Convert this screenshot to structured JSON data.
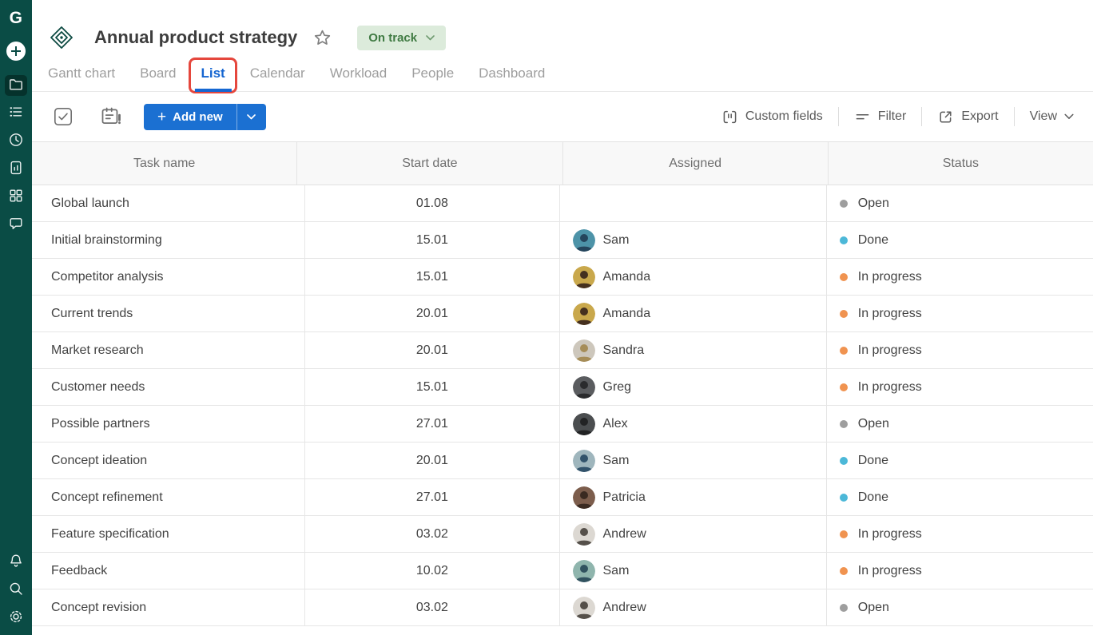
{
  "app": {
    "logo_letter": "G"
  },
  "sidebar": {
    "items": [
      {
        "name": "projects",
        "icon": "folder-icon",
        "active": true
      },
      {
        "name": "task-list",
        "icon": "list-icon",
        "active": false
      },
      {
        "name": "history",
        "icon": "clock-icon",
        "active": false
      },
      {
        "name": "reports",
        "icon": "report-icon",
        "active": false
      },
      {
        "name": "portfolio",
        "icon": "grid-icon",
        "active": false
      },
      {
        "name": "comments",
        "icon": "chat-icon",
        "active": false
      }
    ],
    "bottom_items": [
      {
        "name": "notifications",
        "icon": "bell-icon"
      },
      {
        "name": "search",
        "icon": "search-icon"
      },
      {
        "name": "settings",
        "icon": "gear-icon"
      }
    ]
  },
  "header": {
    "title": "Annual product strategy",
    "status_badge": "On track"
  },
  "tabs": [
    {
      "label": "Gantt chart",
      "active": false,
      "annotated": false
    },
    {
      "label": "Board",
      "active": false,
      "annotated": false
    },
    {
      "label": "List",
      "active": true,
      "annotated": true
    },
    {
      "label": "Calendar",
      "active": false,
      "annotated": false
    },
    {
      "label": "Workload",
      "active": false,
      "annotated": false
    },
    {
      "label": "People",
      "active": false,
      "annotated": false
    },
    {
      "label": "Dashboard",
      "active": false,
      "annotated": false
    }
  ],
  "toolbar": {
    "add_new_plus": "+",
    "add_new_label": "Add new",
    "custom_fields_label": "Custom fields",
    "filter_label": "Filter",
    "export_label": "Export",
    "view_label": "View"
  },
  "table": {
    "columns": [
      "Task name",
      "Start date",
      "Assigned",
      "Status"
    ],
    "status_colors": {
      "Open": "#9e9e9e",
      "Done": "#4cb8d8",
      "In progress": "#f09350"
    },
    "rows": [
      {
        "task": "Global launch",
        "start": "01.08",
        "assignee": null,
        "status": "Open"
      },
      {
        "task": "Initial brainstorming",
        "start": "15.01",
        "assignee": {
          "name": "Sam",
          "avatar_bg": "#4d93a8",
          "avatar_fg": "#25455c"
        },
        "status": "Done"
      },
      {
        "task": "Competitor analysis",
        "start": "15.01",
        "assignee": {
          "name": "Amanda",
          "avatar_bg": "#c9a84c",
          "avatar_fg": "#45301f"
        },
        "status": "In progress"
      },
      {
        "task": "Current trends",
        "start": "20.01",
        "assignee": {
          "name": "Amanda",
          "avatar_bg": "#c9a84c",
          "avatar_fg": "#45301f"
        },
        "status": "In progress"
      },
      {
        "task": "Market research",
        "start": "20.01",
        "assignee": {
          "name": "Sandra",
          "avatar_bg": "#cdc7bc",
          "avatar_fg": "#a68d58"
        },
        "status": "In progress"
      },
      {
        "task": "Customer needs",
        "start": "15.01",
        "assignee": {
          "name": "Greg",
          "avatar_bg": "#5a5c5f",
          "avatar_fg": "#2a2b2d"
        },
        "status": "In progress"
      },
      {
        "task": "Possible partners",
        "start": "27.01",
        "assignee": {
          "name": "Alex",
          "avatar_bg": "#4b4e50",
          "avatar_fg": "#222324"
        },
        "status": "Open"
      },
      {
        "task": "Concept ideation",
        "start": "20.01",
        "assignee": {
          "name": "Sam",
          "avatar_bg": "#9fb6bd",
          "avatar_fg": "#32536b"
        },
        "status": "Done"
      },
      {
        "task": "Concept refinement",
        "start": "27.01",
        "assignee": {
          "name": "Patricia",
          "avatar_bg": "#7c5d4c",
          "avatar_fg": "#3a2a21"
        },
        "status": "Done"
      },
      {
        "task": "Feature specification",
        "start": "03.02",
        "assignee": {
          "name": "Andrew",
          "avatar_bg": "#dcd8d2",
          "avatar_fg": "#55504a"
        },
        "status": "In progress"
      },
      {
        "task": "Feedback",
        "start": "10.02",
        "assignee": {
          "name": "Sam",
          "avatar_bg": "#8fb5ad",
          "avatar_fg": "#31525f"
        },
        "status": "In progress"
      },
      {
        "task": "Concept revision",
        "start": "03.02",
        "assignee": {
          "name": "Andrew",
          "avatar_bg": "#dcd8d2",
          "avatar_fg": "#55504a"
        },
        "status": "Open"
      }
    ]
  },
  "colors": {
    "sidebar_bg": "#0a4c45",
    "sidebar_active_bg": "#05322c",
    "primary_blue": "#1b70d2",
    "tab_active_blue": "#1465d1",
    "badge_bg": "#dcebdb",
    "badge_text": "#3f7a42",
    "annotation_red": "#e5473d"
  }
}
